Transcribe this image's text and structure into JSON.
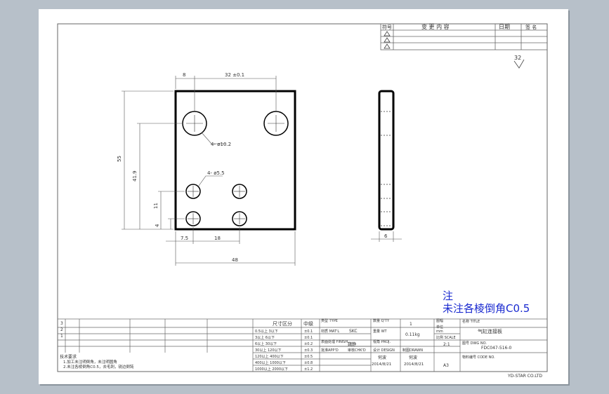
{
  "revision_table": {
    "header_mark": "符号",
    "header_content": "变  更  内  容",
    "header_date": "日期",
    "header_sign": "签 名"
  },
  "roughness": "32",
  "dimensions": {
    "top_left_gap": "8",
    "top_hole_spacing": "32 ±0.1",
    "overall_height": "55",
    "top_hole_height": "41.9",
    "bottom_hole_row": "11",
    "bottom_offset": "4",
    "large_hole_dia": "4- ø10.2",
    "small_hole_dia": "4- ø5.5",
    "left_offset": "7.5",
    "small_hole_spacing": "18",
    "overall_width": "48",
    "thickness": "6"
  },
  "note": {
    "title": "注",
    "body": "未注各棱倒角C0.5"
  },
  "title_block": {
    "tolerance_header": "尺寸区分",
    "grade_header": "中级",
    "tolerances": [
      {
        "range": "0.5以上  3以下",
        "value": "±0.1"
      },
      {
        "range": "3以上    6以下",
        "value": "±0.1"
      },
      {
        "range": "6以上   30以下",
        "value": "±0.2"
      },
      {
        "range": "30以上  120以下",
        "value": "±0.3"
      },
      {
        "range": "120以上 400以下",
        "value": "±0.5"
      },
      {
        "range": "400以上 1000以下",
        "value": "±0.8"
      },
      {
        "range": "1000以上 2000以下",
        "value": "±1.2"
      }
    ],
    "type_label": "类型 TYPE",
    "material_label": "材质 MAT'L",
    "material_value": "SKC",
    "finish_label": "表面处理 FINISH",
    "approve_label": "批准APP'D",
    "check_label": "审核CHK'D",
    "reviewer_name": "魏静",
    "design_label": "设计 DESIGN",
    "design_date": "2014/8/21",
    "drawn_label": "制图DRAWN",
    "drawn_date": "2014/8/21",
    "designer_name": "何波",
    "drafter_name": "何波",
    "qty_label": "数量 Q'TY",
    "qty_value": "1",
    "weight_label": "重量 WT",
    "weight_value": "0.11kg",
    "size_label": "图幅",
    "size_value": "A3",
    "unit_label": "单位",
    "unit_value": "mm",
    "scale_label": "比例 SCALE",
    "scale_value": "2:1",
    "proj_label": "视角 PROJ.",
    "title_label": "名称 TITLE",
    "title_value": "气缸连接板",
    "dwg_label": "图号 DWG NO.",
    "dwg_value": "FDC047-516-0",
    "code_label": "物料编号 CODE NO.",
    "company": "YD-STAR CO.LTD",
    "tech_req_title": "技术要求",
    "tech_req_1": "1.加工未注明倒角，未注明圆角",
    "tech_req_2": "2.未注各棱倒角C0.5，去毛刺，锐边倒钝",
    "rev_marks": [
      "3",
      "2",
      "1"
    ]
  }
}
